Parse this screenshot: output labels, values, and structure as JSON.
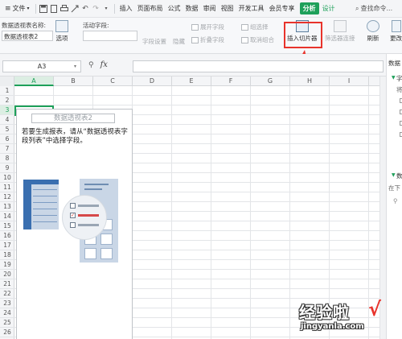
{
  "menubar": {
    "file_label": "文件",
    "items": [
      "插入",
      "页面布局",
      "公式",
      "数据",
      "审阅",
      "视图",
      "开发工具",
      "会员专享"
    ],
    "active_tab": "分析",
    "design_tab": "设计",
    "search_label": "查找命令..."
  },
  "ribbon": {
    "pivot_name_label": "数据透视表名称:",
    "pivot_name_value": "数据透视表2",
    "options_label": "选项",
    "active_field_label": "活动字段:",
    "field_settings": "字段设置",
    "hide": "隐藏",
    "expand_field": "展开字段",
    "collapse_field": "折叠字段",
    "group_selection": "组选择",
    "ungroup": "取消组合",
    "insert_slicer": "插入切片器",
    "filter_connections": "筛选器连接",
    "refresh": "刷新",
    "change": "更改"
  },
  "formula_bar": {
    "cell_ref": "A3",
    "fx": "fx",
    "formula": ""
  },
  "columns": [
    "A",
    "B",
    "C",
    "D",
    "E",
    "F",
    "G",
    "H",
    "I"
  ],
  "rows": [
    "1",
    "2",
    "3",
    "4",
    "5",
    "6",
    "7",
    "8",
    "9",
    "10",
    "11",
    "12",
    "13",
    "14",
    "15",
    "16",
    "17",
    "18",
    "19",
    "20",
    "21",
    "22",
    "23",
    "24",
    "25",
    "26"
  ],
  "active_cell": {
    "col": "A",
    "row": "3"
  },
  "pivot": {
    "title": "数据透视表2",
    "instruction": "若要生成报表，请从“数据透视表字段列表”中选择字段。"
  },
  "task_pane": {
    "title": "数据",
    "section1": "字",
    "label_jiang": "将",
    "section2": "数",
    "label_zaixia": "在下"
  },
  "watermark": {
    "cn": "经验啦",
    "url": "jingyanla.com",
    "check": "√"
  },
  "colors": {
    "accent": "#1ea05a",
    "highlight": "#e8332b"
  }
}
